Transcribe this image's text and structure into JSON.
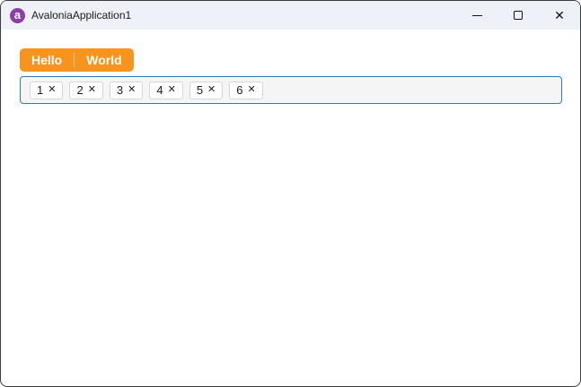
{
  "window": {
    "title": "AvaloniaApplication1",
    "app_icon_letter": "a",
    "controls": {
      "minimize": "minimize",
      "maximize": "maximize",
      "close_glyph": "✕"
    }
  },
  "toolbar": {
    "hello_label": "Hello",
    "world_label": "World"
  },
  "tags": {
    "items": [
      "1",
      "2",
      "3",
      "4",
      "5",
      "6"
    ],
    "remove_glyph": "✕"
  },
  "colors": {
    "accent_orange": "#f7941d",
    "focus_border": "#2a7db4",
    "titlebar_bg": "#eef2f8",
    "icon_purple": "#8b3fa8",
    "window_border": "#3c3c3c"
  }
}
